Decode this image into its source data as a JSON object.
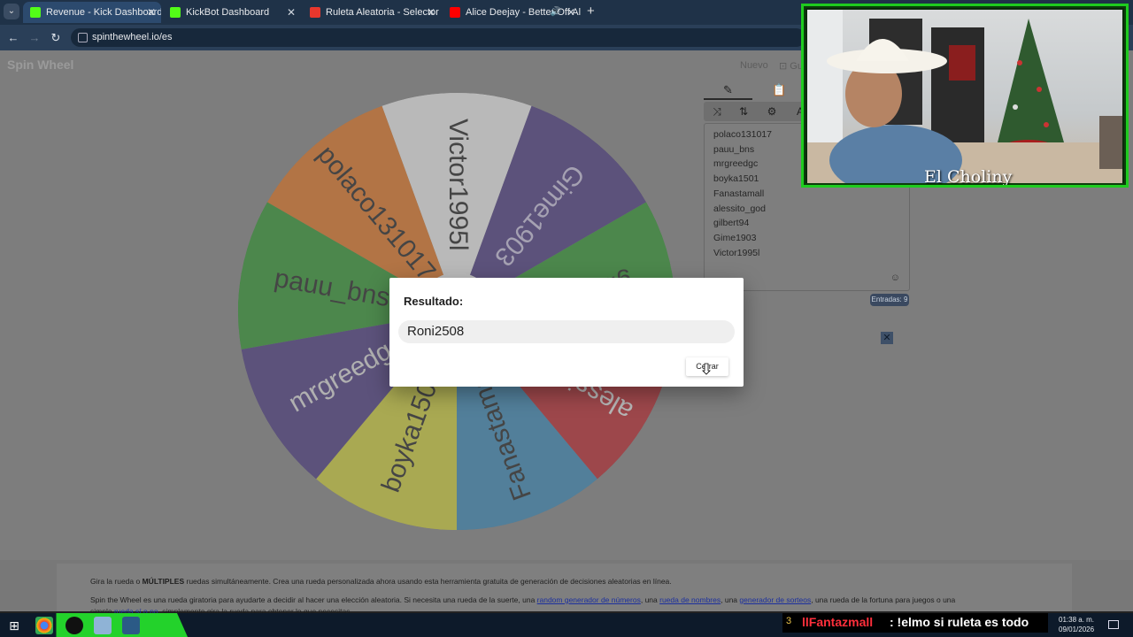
{
  "browser": {
    "tabs": [
      {
        "title": "Revenue - Kick Dashboard",
        "favicon_color": "#53fc18",
        "active": true
      },
      {
        "title": "KickBot Dashboard",
        "favicon_color": "#53fc18",
        "active": false
      },
      {
        "title": "Ruleta Aleatoria - Selector Pers",
        "favicon_color": "#e8372d",
        "active": false
      },
      {
        "title": "Alice Deejay - Better Off Al",
        "favicon_color": "#ff0000",
        "active": false
      }
    ],
    "url": "spinthewheel.io/es",
    "new_tab_label": "+"
  },
  "app": {
    "logo": "Spin Wheel",
    "new_label": "Nuevo",
    "save_label": "Gu"
  },
  "wheel": {
    "segments": [
      {
        "label": "Victor1995l",
        "color": "#eeeeee",
        "text_color": "#111111"
      },
      {
        "label": "Gime1903",
        "color": "#3d2a78",
        "text_color": "#c8c0e0"
      },
      {
        "label": "gilbert94",
        "color": "#1e8f1e",
        "text_color": "#111111"
      },
      {
        "label": "alessito_god",
        "color": "#b8141c",
        "text_color": "#e8e8e8"
      },
      {
        "label": "Fanastamall",
        "color": "#2a7fb2",
        "text_color": "#111111"
      },
      {
        "label": "boyka1501",
        "color": "#cfcf2a",
        "text_color": "#111111"
      },
      {
        "label": "mrgreedgc",
        "color": "#3d2a78",
        "text_color": "#dcdcdc"
      },
      {
        "label": "pauu_bns",
        "color": "#1e8f1e",
        "text_color": "#111111"
      },
      {
        "label": "polaco131017",
        "color": "#e16a10",
        "text_color": "#111111"
      }
    ]
  },
  "panel": {
    "entries": [
      "polaco131017",
      "pauu_bns",
      "mrgreedgc",
      "boyka1501",
      "Fanastamall",
      "alessito_god",
      "gilbert94",
      "Gime1903",
      "Victor1995l"
    ],
    "entries_count_label": "Entradas: 9"
  },
  "modal": {
    "title": "Resultado:",
    "result": "Roni2508",
    "close_label": "Cerrar"
  },
  "info": {
    "line1_prefix": "Gira la rueda o ",
    "line1_bold": "MÚLTIPLES",
    "line1_rest": " ruedas simultáneamente. Crea una rueda personalizada ahora usando esta herramienta gratuita de generación de decisiones aleatorias en línea.",
    "line2_a": "Spin the Wheel es una rueda giratoria para ayudarte a decidir al hacer una elección aleatoria. Si necesita una rueda de la suerte, una ",
    "link1": "random generador de números",
    "line2_b": ", una ",
    "link2": "rueda de nombres",
    "line2_c": ", una ",
    "link3": "generador de sorteos",
    "line2_d": ", una rueda de la fortuna para juegos o una",
    "line3_a": "simple ",
    "link4": "rueda sí o no",
    "line3_b": ", simplemente gira la rueda para obtener lo que necesitas."
  },
  "stream": {
    "cam_name": "El Choliny",
    "chat_user": "llFantazmall",
    "chat_message": ": !elmo si ruleta es todo",
    "badge_icon": "sub-badge-icon"
  },
  "taskbar": {
    "time": "01:38 a. m.",
    "date": "09/01/2026"
  }
}
